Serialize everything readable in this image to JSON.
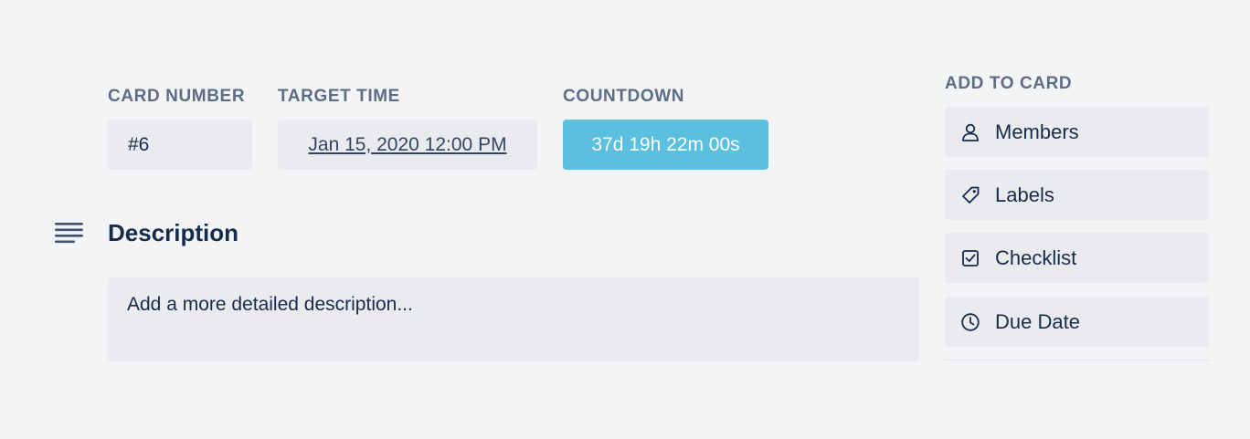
{
  "card_number": {
    "label": "CARD NUMBER",
    "value": "#6"
  },
  "target_time": {
    "label": "TARGET TIME",
    "value": "Jan 15, 2020 12:00 PM"
  },
  "countdown": {
    "label": "COUNTDOWN",
    "value": "37d 19h 22m 00s",
    "color": "#5bbfde"
  },
  "description": {
    "title": "Description",
    "placeholder": "Add a more detailed description..."
  },
  "add_to_card": {
    "title": "ADD TO CARD",
    "items": [
      {
        "label": "Members",
        "icon": "person-icon"
      },
      {
        "label": "Labels",
        "icon": "tag-icon"
      },
      {
        "label": "Checklist",
        "icon": "checkbox-icon"
      },
      {
        "label": "Due Date",
        "icon": "clock-icon"
      }
    ]
  }
}
